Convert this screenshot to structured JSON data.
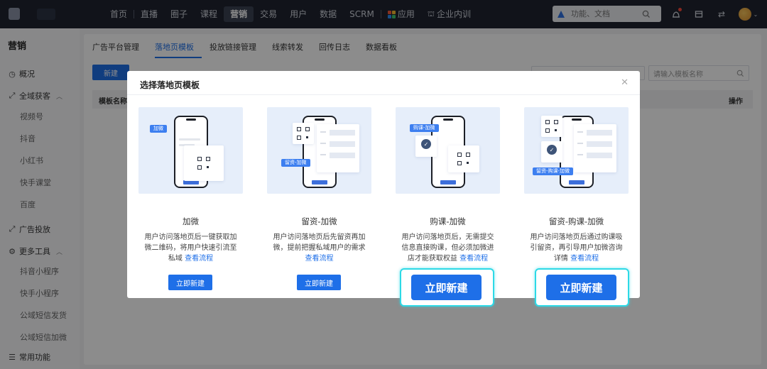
{
  "topnav": {
    "items": [
      "首页",
      "直播",
      "圈子",
      "课程",
      "营销",
      "交易",
      "用户",
      "数据",
      "SCRM",
      "应用",
      "企业内训"
    ],
    "active": "营销",
    "search_placeholder": "功能、文档"
  },
  "sidebar": {
    "title": "营销",
    "overview": "概况",
    "acquire": "全域获客",
    "acquire_subs": [
      "视频号",
      "抖音",
      "小红书",
      "快手课堂",
      "百度"
    ],
    "ads": "广告投放",
    "more_tools": "更多工具",
    "more_subs": [
      "抖音小程序",
      "快手小程序",
      "公域短信发货",
      "公域短信加微"
    ],
    "common": "常用功能"
  },
  "main": {
    "tabs": [
      "广告平台管理",
      "落地页模板",
      "投放链接管理",
      "线索转发",
      "回传日志",
      "数据看板"
    ],
    "active_tab": "落地页模板",
    "new_button": "新建",
    "search_placeholder": "请输入模板名称",
    "col_name": "模板名称",
    "col_action": "操作"
  },
  "modal": {
    "title": "选择落地页模板",
    "link_text": "查看流程",
    "cards": [
      {
        "title": "加微",
        "desc": "用户访问落地页后一键获取加微二维码，将用户快速引流至私域",
        "button": "立即新建",
        "tag": "加微"
      },
      {
        "title": "留资-加微",
        "desc": "用户访问落地页后先留资再加微，提前把握私域用户的需求",
        "button": "立即新建",
        "tag": "留资-加微"
      },
      {
        "title": "购课-加微",
        "desc": "用户访问落地页后，无需提交信息直接购课，但必须加微进店才能获取权益",
        "button": "立即新建",
        "tag": "购课-加微"
      },
      {
        "title": "留资-购课-加微",
        "desc": "用户访问落地页后通过购课吸引留资，再引导用户加微咨询详情",
        "button": "立即新建",
        "tag": "留资-购课-加微"
      }
    ]
  },
  "colors": {
    "primary": "#1e6fe8",
    "highlight": "#2dd9e6",
    "topbar": "#1f2430"
  }
}
